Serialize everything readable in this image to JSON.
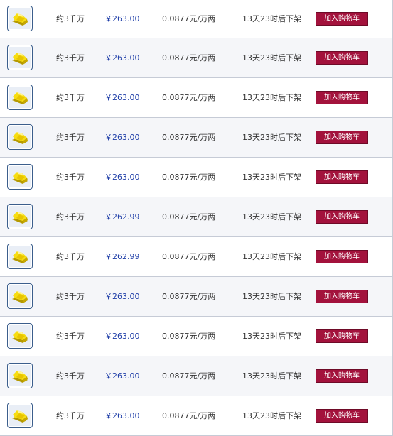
{
  "colors": {
    "price_text": "#1f3ea8",
    "button_bg": "#a3123c",
    "row_border": "#c6cbd6",
    "thumb_border": "#3b5e8c"
  },
  "listings": [
    {
      "icon": "gold-bars-icon",
      "quantity": "约3千万",
      "price": "￥263.00",
      "rate": "0.0877元/万两",
      "time_left": "13天23时后下架",
      "button": "加入购物车"
    },
    {
      "icon": "gold-bars-icon",
      "quantity": "约3千万",
      "price": "￥263.00",
      "rate": "0.0877元/万两",
      "time_left": "13天23时后下架",
      "button": "加入购物车"
    },
    {
      "icon": "gold-bars-icon",
      "quantity": "约3千万",
      "price": "￥263.00",
      "rate": "0.0877元/万两",
      "time_left": "13天23时后下架",
      "button": "加入购物车"
    },
    {
      "icon": "gold-bars-icon",
      "quantity": "约3千万",
      "price": "￥263.00",
      "rate": "0.0877元/万两",
      "time_left": "13天23时后下架",
      "button": "加入购物车"
    },
    {
      "icon": "gold-bars-icon",
      "quantity": "约3千万",
      "price": "￥263.00",
      "rate": "0.0877元/万两",
      "time_left": "13天23时后下架",
      "button": "加入购物车"
    },
    {
      "icon": "gold-bars-icon",
      "quantity": "约3千万",
      "price": "￥262.99",
      "rate": "0.0877元/万两",
      "time_left": "13天23时后下架",
      "button": "加入购物车"
    },
    {
      "icon": "gold-bars-icon",
      "quantity": "约3千万",
      "price": "￥262.99",
      "rate": "0.0877元/万两",
      "time_left": "13天23时后下架",
      "button": "加入购物车"
    },
    {
      "icon": "gold-bars-icon",
      "quantity": "约3千万",
      "price": "￥263.00",
      "rate": "0.0877元/万两",
      "time_left": "13天23时后下架",
      "button": "加入购物车"
    },
    {
      "icon": "gold-bars-icon",
      "quantity": "约3千万",
      "price": "￥263.00",
      "rate": "0.0877元/万两",
      "time_left": "13天23时后下架",
      "button": "加入购物车"
    },
    {
      "icon": "gold-bars-icon",
      "quantity": "约3千万",
      "price": "￥263.00",
      "rate": "0.0877元/万两",
      "time_left": "13天23时后下架",
      "button": "加入购物车"
    },
    {
      "icon": "gold-bars-icon",
      "quantity": "约3千万",
      "price": "￥263.00",
      "rate": "0.0877元/万两",
      "time_left": "13天23时后下架",
      "button": "加入购物车"
    }
  ]
}
